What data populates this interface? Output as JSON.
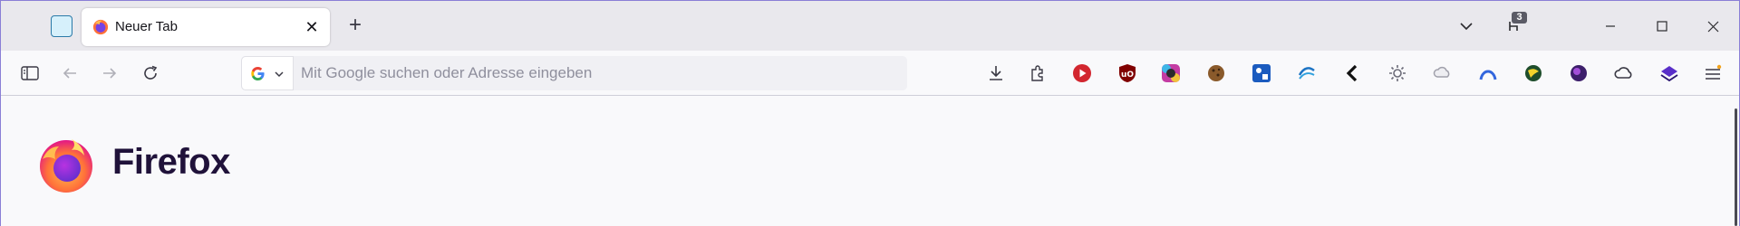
{
  "tab": {
    "title": "Neuer Tab"
  },
  "toolbar": {
    "downloads_badge": "3"
  },
  "urlbar": {
    "placeholder": "Mit Google suchen oder Adresse eingeben",
    "value": ""
  },
  "newtab": {
    "brand": "Firefox"
  },
  "colors": {
    "titlebar": "#e9e8ed",
    "toolbar": "#f9f9fb",
    "window_border": "#8a7fd6",
    "brand_text": "#20123a"
  }
}
